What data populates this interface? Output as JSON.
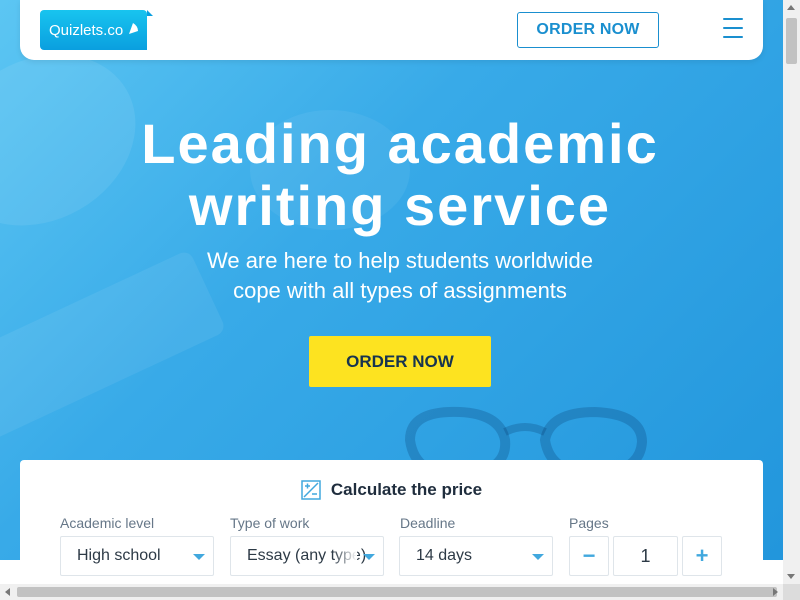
{
  "header": {
    "logo_text": "Quizlets.co",
    "order_label": "ORDER NOW",
    "menu_icon": "hamburger-menu-icon"
  },
  "hero": {
    "title_line1": "Leading academic",
    "title_line2": "writing service",
    "subtitle_line1": "We are here to help students worldwide",
    "subtitle_line2": "cope with all types of assignments",
    "order_label": "ORDER NOW"
  },
  "calculator": {
    "title": "Calculate the price",
    "icon": "calculator-icon",
    "academic_level": {
      "label": "Academic level",
      "value": "High school"
    },
    "type_of_work": {
      "label": "Type of work",
      "value": "Essay (any type)"
    },
    "deadline": {
      "label": "Deadline",
      "value": "14 days"
    },
    "pages": {
      "label": "Pages",
      "value": "1",
      "minus": "−",
      "plus": "+"
    }
  },
  "colors": {
    "accent_blue": "#1a8fcf",
    "cta_yellow": "#fde320",
    "hero_gradient_start": "#5cc6f3",
    "hero_gradient_end": "#2296dc"
  }
}
